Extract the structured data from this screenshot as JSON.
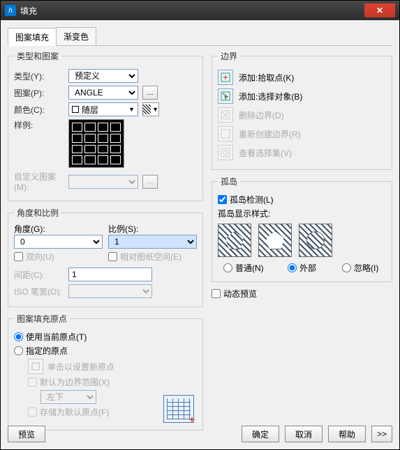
{
  "window": {
    "title": "填充",
    "app_icon": "h"
  },
  "tabs": {
    "pattern": "图案填充",
    "gradient": "渐变色"
  },
  "type_pattern": {
    "legend": "类型和图案",
    "type_label": "类型(Y):",
    "type_value": "预定义",
    "pattern_label": "图案(P):",
    "pattern_value": "ANGLE",
    "pattern_browse": "...",
    "color_label": "颜色(C):",
    "color_value": "随层",
    "swatch_label": "样例:",
    "custom_label": "自定义图案(M):"
  },
  "angle_scale": {
    "legend": "角度和比例",
    "angle_label": "角度(G):",
    "angle_value": "0",
    "scale_label": "比例(S):",
    "scale_value": "1",
    "bidir": "双向(U)",
    "rel_paper": "相对图纸空间(E)",
    "spacing_label": "间距(C):",
    "spacing_value": "1",
    "iso_label": "ISO 笔宽(O):"
  },
  "origin": {
    "legend": "图案填充原点",
    "use_current": "使用当前原点(T)",
    "specified": "指定的原点",
    "click_set": "单击以设置新原点",
    "default_extents": "默认为边界范围(X)",
    "position_value": "左下",
    "store_default": "存储为默认原点(F)"
  },
  "boundary": {
    "legend": "边界",
    "add_pick": "添加:拾取点(K)",
    "add_select": "添加:选择对象(B)",
    "remove": "删除边界(D)",
    "recreate": "重新创建边界(R)",
    "view_sel": "查看选择集(V)"
  },
  "islands": {
    "legend": "孤岛",
    "detect": "孤岛检测(L)",
    "style_label": "孤岛显示样式:",
    "normal": "普通(N)",
    "outer": "外部",
    "ignore": "忽略(I)"
  },
  "dynamic_preview": "动态预览",
  "footer": {
    "preview": "预览",
    "ok": "确定",
    "cancel": "取消",
    "help": "帮助",
    "expand": ">>"
  }
}
